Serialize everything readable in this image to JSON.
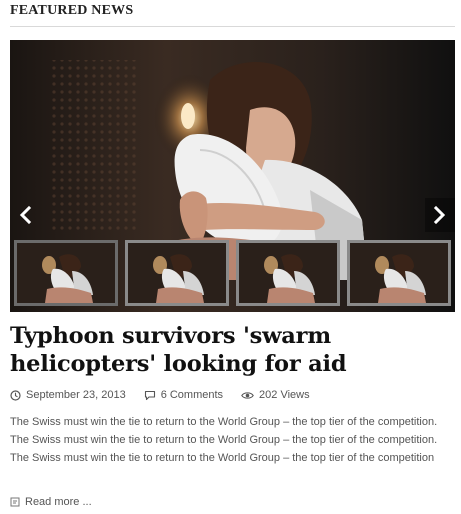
{
  "section": {
    "title": "FEATURED NEWS"
  },
  "slider": {
    "prev_icon": "chevron-left-icon",
    "next_icon": "chevron-right-icon",
    "thumbnail_count": 4
  },
  "article": {
    "title": "Typhoon survivors 'swarm helicopters' looking for aid",
    "date": "September 23, 2013",
    "comments": "6 Comments",
    "views": "202 Views",
    "excerpt": "The Swiss must win the tie to return to the World Group – the top tier of the competition. The Swiss must win the tie to return to the World Group – the top tier of the competition. The Swiss must win the tie to return to the World Group – the top tier of the competition",
    "read_more": "Read more ..."
  },
  "icons": {
    "date": "clock-icon",
    "comments": "comment-bubble-icon",
    "views": "eye-icon",
    "read_more": "document-icon"
  },
  "colors": {
    "headline": "#111111",
    "meta_text": "#555555",
    "divider": "#d9d9d9",
    "slider_bg": "#141414"
  }
}
